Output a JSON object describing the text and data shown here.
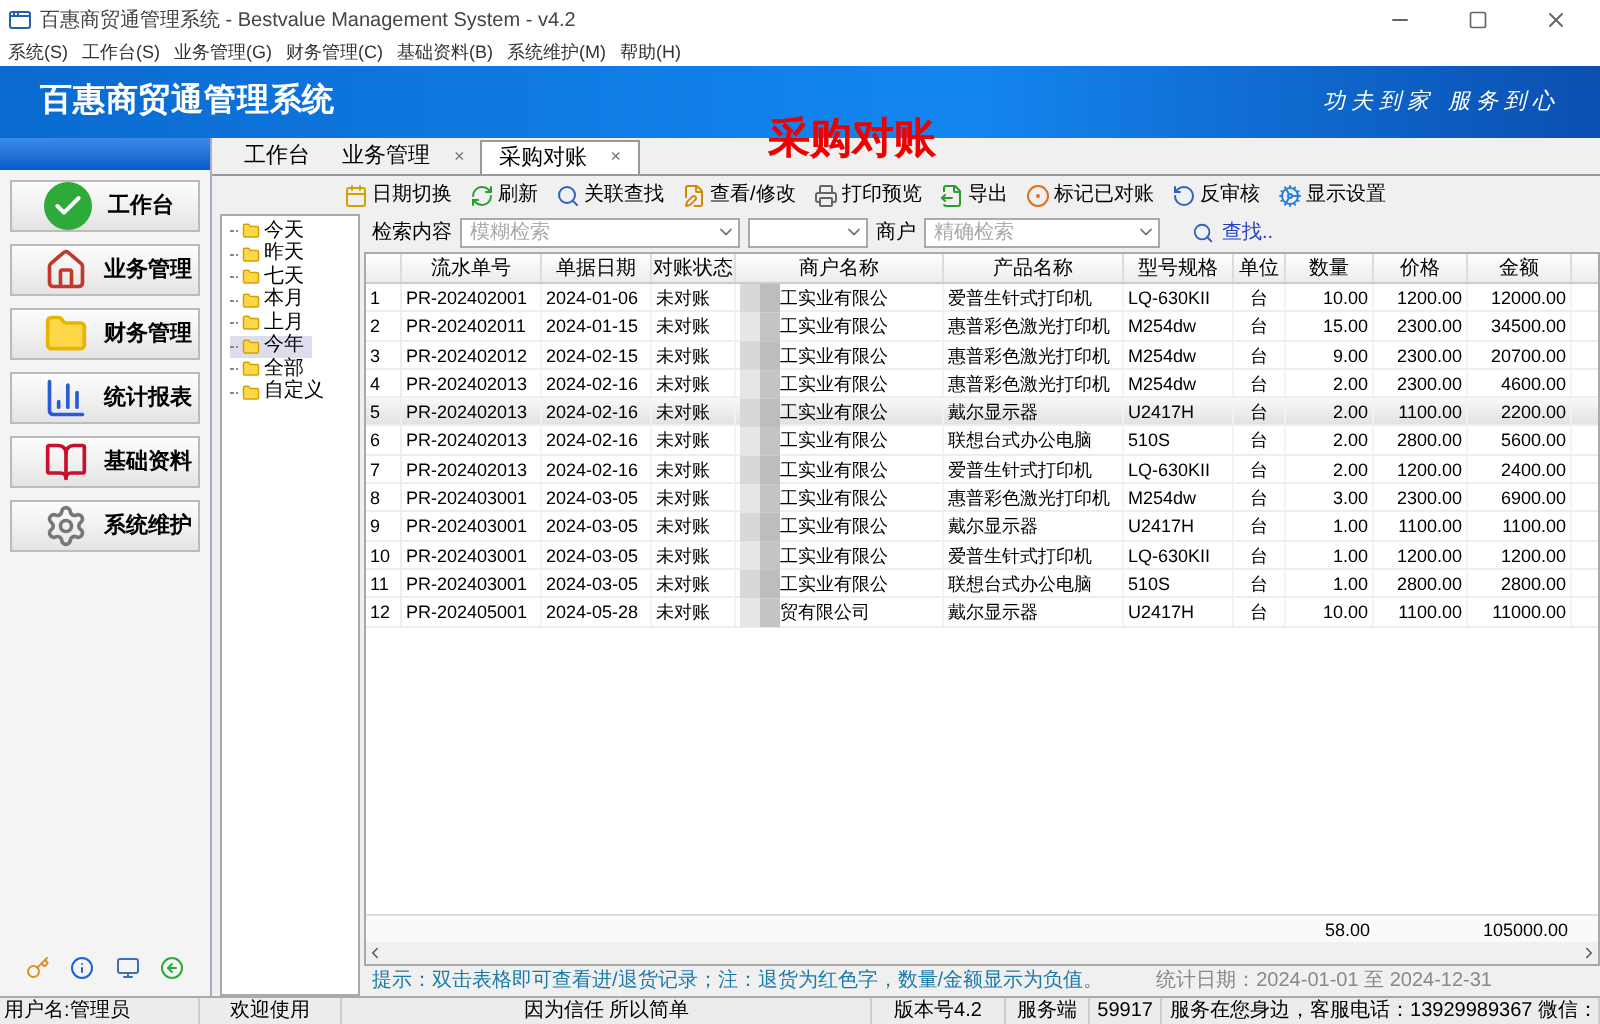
{
  "window": {
    "title": "百惠商贸通管理系统 - Bestvalue Management System - v4.2"
  },
  "menu": [
    "系统(S)",
    "工作台(S)",
    "业务管理(G)",
    "财务管理(C)",
    "基础资料(B)",
    "系统维护(M)",
    "帮助(H)"
  ],
  "banner": {
    "title": "百惠商贸通管理系统",
    "slogan": "功夫到家 服务到心"
  },
  "page_heading": "采购对账",
  "sidebar": {
    "items": [
      {
        "label": "工作台",
        "kind": "check"
      },
      {
        "label": "业务管理",
        "kind": "house"
      },
      {
        "label": "财务管理",
        "kind": "folder"
      },
      {
        "label": "统计报表",
        "kind": "chart"
      },
      {
        "label": "基础资料",
        "kind": "book"
      },
      {
        "label": "系统维护",
        "kind": "gear"
      }
    ]
  },
  "tabs": [
    {
      "label": "工作台",
      "selected": false
    },
    {
      "label": "业务管理",
      "selected": false,
      "close": "×"
    },
    {
      "label": "采购对账",
      "selected": true,
      "close": "×"
    }
  ],
  "toolbar": [
    {
      "label": "日期切换",
      "kind": "calendar"
    },
    {
      "label": "刷新",
      "kind": "refresh"
    },
    {
      "label": "关联查找",
      "kind": "search"
    },
    {
      "label": "查看/修改",
      "kind": "edit"
    },
    {
      "label": "打印预览",
      "kind": "print"
    },
    {
      "label": "导出",
      "kind": "export"
    },
    {
      "label": "标记已对账",
      "kind": "mark"
    },
    {
      "label": "反审核",
      "kind": "undo"
    },
    {
      "label": "显示设置",
      "kind": "settings"
    }
  ],
  "tree": [
    {
      "label": "今天",
      "selected": false
    },
    {
      "label": "昨天",
      "selected": false
    },
    {
      "label": "七天",
      "selected": false
    },
    {
      "label": "本月",
      "selected": false
    },
    {
      "label": "上月",
      "selected": false
    },
    {
      "label": "今年",
      "selected": true
    },
    {
      "label": "全部",
      "selected": false
    },
    {
      "label": "自定义",
      "selected": false
    }
  ],
  "search": {
    "label": "检索内容",
    "placeholder": "模糊检索",
    "merchant_label": "商户",
    "merchant_placeholder": "精确检索",
    "find": "查找.."
  },
  "table": {
    "columns": [
      "流水单号",
      "单据日期",
      "对账状态",
      "商户名称",
      "产品名称",
      "型号规格",
      "单位",
      "数量",
      "价格",
      "金额"
    ],
    "rows": [
      {
        "index": "1",
        "cells": [
          "PR-202402001",
          "2024-01-06",
          "未对账",
          "工实业有限公",
          "爱普生针式打印机",
          "LQ-630KII",
          "台",
          "10.00",
          "1200.00",
          "12000.00"
        ],
        "selected": false
      },
      {
        "index": "2",
        "cells": [
          "PR-202402011",
          "2024-01-15",
          "未对账",
          "工实业有限公",
          "惠普彩色激光打印机",
          "M254dw",
          "台",
          "15.00",
          "2300.00",
          "34500.00"
        ],
        "selected": false
      },
      {
        "index": "3",
        "cells": [
          "PR-202402012",
          "2024-02-15",
          "未对账",
          "工实业有限公",
          "惠普彩色激光打印机",
          "M254dw",
          "台",
          "9.00",
          "2300.00",
          "20700.00"
        ],
        "selected": false
      },
      {
        "index": "4",
        "cells": [
          "PR-202402013",
          "2024-02-16",
          "未对账",
          "工实业有限公",
          "惠普彩色激光打印机",
          "M254dw",
          "台",
          "2.00",
          "2300.00",
          "4600.00"
        ],
        "selected": false
      },
      {
        "index": "5",
        "cells": [
          "PR-202402013",
          "2024-02-16",
          "未对账",
          "工实业有限公",
          "戴尔显示器",
          "U2417H",
          "台",
          "2.00",
          "1100.00",
          "2200.00"
        ],
        "selected": true
      },
      {
        "index": "6",
        "cells": [
          "PR-202402013",
          "2024-02-16",
          "未对账",
          "工实业有限公",
          "联想台式办公电脑",
          "510S",
          "台",
          "2.00",
          "2800.00",
          "5600.00"
        ],
        "selected": false
      },
      {
        "index": "7",
        "cells": [
          "PR-202402013",
          "2024-02-16",
          "未对账",
          "工实业有限公",
          "爱普生针式打印机",
          "LQ-630KII",
          "台",
          "2.00",
          "1200.00",
          "2400.00"
        ],
        "selected": false
      },
      {
        "index": "8",
        "cells": [
          "PR-202403001",
          "2024-03-05",
          "未对账",
          "工实业有限公",
          "惠普彩色激光打印机",
          "M254dw",
          "台",
          "3.00",
          "2300.00",
          "6900.00"
        ],
        "selected": false
      },
      {
        "index": "9",
        "cells": [
          "PR-202403001",
          "2024-03-05",
          "未对账",
          "工实业有限公",
          "戴尔显示器",
          "U2417H",
          "台",
          "1.00",
          "1100.00",
          "1100.00"
        ],
        "selected": false
      },
      {
        "index": "10",
        "cells": [
          "PR-202403001",
          "2024-03-05",
          "未对账",
          "工实业有限公",
          "爱普生针式打印机",
          "LQ-630KII",
          "台",
          "1.00",
          "1200.00",
          "1200.00"
        ],
        "selected": false
      },
      {
        "index": "11",
        "cells": [
          "PR-202403001",
          "2024-03-05",
          "未对账",
          "工实业有限公",
          "联想台式办公电脑",
          "510S",
          "台",
          "1.00",
          "2800.00",
          "2800.00"
        ],
        "selected": false
      },
      {
        "index": "12",
        "cells": [
          "PR-202405001",
          "2024-05-28",
          "未对账",
          "贸有限公司",
          "戴尔显示器",
          "U2417H",
          "台",
          "10.00",
          "1100.00",
          "11000.00"
        ],
        "selected": false
      }
    ],
    "totals": {
      "quantity": "58.00",
      "amount": "105000.00"
    }
  },
  "hint": "提示：双击表格即可查看进/退货记录；注：退货为红色字，数量/金额显示为负值。",
  "stat_date": "统计日期：2024-01-01 至 2024-12-31",
  "status_bar": [
    "用户名:管理员",
    "欢迎使用",
    "因为信任 所以简单",
    "版本号4.2",
    "服务端",
    "59917",
    "服务在您身边，客服电话：13929989367 微信："
  ]
}
